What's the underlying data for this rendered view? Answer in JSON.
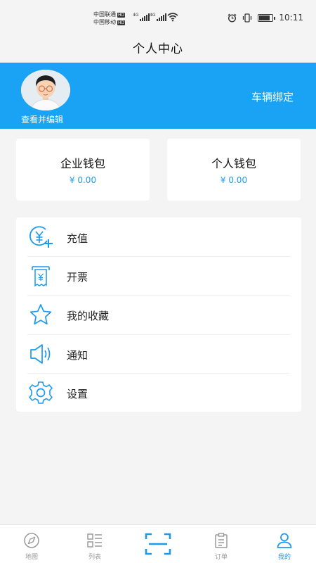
{
  "status_bar": {
    "carrier_1": "中国联通",
    "carrier_2": "中国移动",
    "hd_badge": "HD",
    "network_type": "4G",
    "time": "10:11"
  },
  "header": {
    "title": "个人中心"
  },
  "profile": {
    "edit_caption": "查看并编辑",
    "bind_vehicle_label": "车辆绑定",
    "accent_color": "#1aa3f4"
  },
  "wallets": [
    {
      "title": "企业钱包",
      "balance": "¥ 0.00"
    },
    {
      "title": "个人钱包",
      "balance": "¥ 0.00"
    }
  ],
  "menu": {
    "items": [
      {
        "label": "充值",
        "icon": "recharge-icon"
      },
      {
        "label": "开票",
        "icon": "invoice-icon"
      },
      {
        "label": "我的收藏",
        "icon": "star-icon"
      },
      {
        "label": "通知",
        "icon": "speaker-icon"
      },
      {
        "label": "设置",
        "icon": "gear-icon"
      }
    ]
  },
  "tabbar": {
    "tabs": [
      {
        "label": "地图",
        "icon": "compass-icon"
      },
      {
        "label": "列表",
        "icon": "list-icon"
      },
      {
        "label": "",
        "icon": "scan-icon"
      },
      {
        "label": "订单",
        "icon": "clipboard-icon"
      },
      {
        "label": "我的",
        "icon": "person-icon",
        "active": true
      }
    ]
  }
}
